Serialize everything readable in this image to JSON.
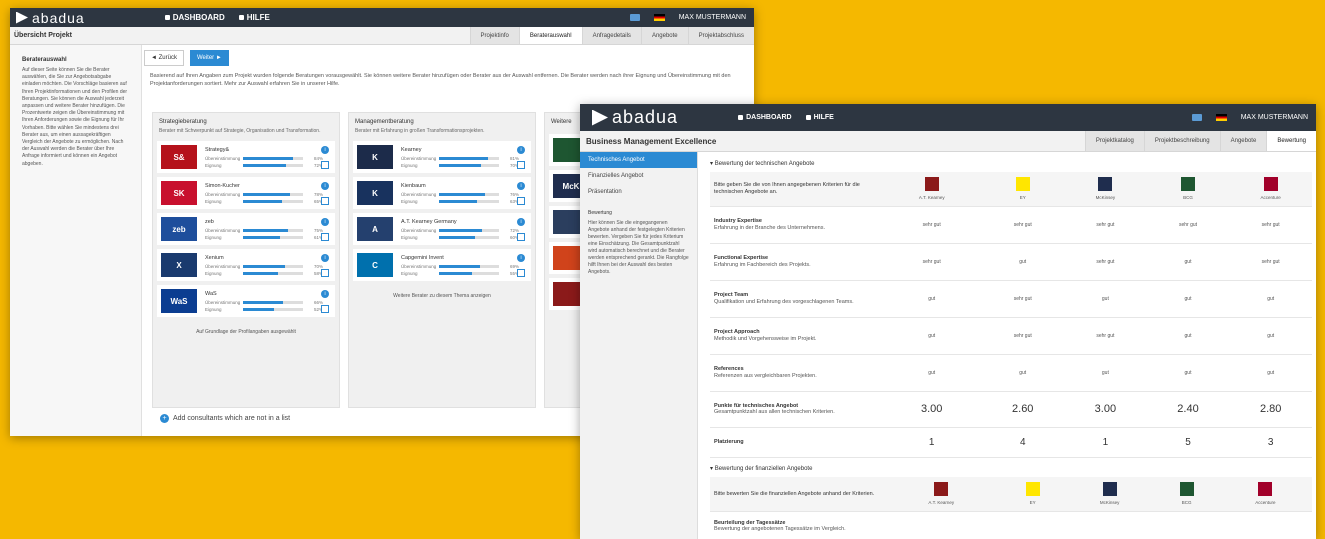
{
  "brand": {
    "name": "abadua",
    "background": "#f5b800",
    "accent": "#2b8ad3",
    "topbar": "#2d3641"
  },
  "w1": {
    "nav": [
      "DASHBOARD",
      "HILFE"
    ],
    "user": "MAX MUSTERMANN",
    "subtitle": "Übersicht Projekt",
    "tabs": [
      {
        "label": "Projektinfo",
        "active": false
      },
      {
        "label": "Beraterauswahl",
        "active": true
      },
      {
        "label": "Anfragedetails",
        "active": false
      },
      {
        "label": "Angebote",
        "active": false
      },
      {
        "label": "Projektabschluss",
        "active": false
      }
    ],
    "sidebar": {
      "heading": "Beraterauswahl",
      "text": "Auf dieser Seite können Sie die Berater auswählen, die Sie zur Angebotsabgabe einladen möchten. Die Vorschläge basieren auf Ihren Projektinformationen und den Profilen der Beratungen. Sie können die Auswahl jederzeit anpassen und weitere Berater hinzufügen. Die Prozentwerte zeigen die Übereinstimmung mit Ihren Anforderungen sowie die Eignung für Ihr Vorhaben. Bitte wählen Sie mindestens drei Berater aus, um einen aussagekräftigen Vergleich der Angebote zu ermöglichen. Nach der Auswahl werden die Berater über Ihre Anfrage informiert und können ein Angebot abgeben."
    },
    "buttons": {
      "back": "◄ Zurück",
      "next": "Weiter ►"
    },
    "intro": "Basierend auf Ihren Angaben zum Projekt wurden folgende Beratungen vorausgewählt. Sie können weitere Berater hinzufügen oder Berater aus der Auswahl entfernen. Die Berater werden nach ihrer Eignung und Übereinstimmung mit den Projektanforderungen sortiert. Mehr zur Auswahl erfahren Sie in unserer Hilfe.",
    "panels": [
      {
        "title": "Strategieberatung",
        "desc": "Berater mit Schwerpunkt auf Strategie, Organisation und Transformation.",
        "cards": [
          {
            "name": "Strategy&",
            "color": "#b5121b",
            "logo": "S&",
            "m1": 84,
            "m2": 72
          },
          {
            "name": "Simon-Kucher",
            "color": "#c8102e",
            "logo": "SK",
            "m1": 78,
            "m2": 65
          },
          {
            "name": "zeb",
            "color": "#1e4e9c",
            "logo": "zeb",
            "m1": 75,
            "m2": 61
          },
          {
            "name": "Xenium",
            "color": "#1a3a6e",
            "logo": "X",
            "m1": 70,
            "m2": 58
          },
          {
            "name": "WaS",
            "color": "#0b3d91",
            "logo": "WaS",
            "m1": 66,
            "m2": 52
          }
        ],
        "foot": "Auf Grundlage der Profilangaben ausgewählt"
      },
      {
        "title": "Managementberatung",
        "desc": "Berater mit Erfahrung in großen Transformationsprojekten.",
        "cards": [
          {
            "name": "Kearney",
            "color": "#1c2b4a",
            "logo": "K",
            "m1": 81,
            "m2": 70
          },
          {
            "name": "Kienbaum",
            "color": "#18325e",
            "logo": "K",
            "m1": 76,
            "m2": 63
          },
          {
            "name": "A.T. Kearney Germany",
            "color": "#24406e",
            "logo": "A",
            "m1": 72,
            "m2": 60
          },
          {
            "name": "Capgemini Invent",
            "color": "#0070ad",
            "logo": "C",
            "m1": 69,
            "m2": 55
          }
        ],
        "foot": "Weitere Berater zu diesem Thema anzeigen"
      },
      {
        "title": "Weitere",
        "desc": "",
        "cards": [
          {
            "name": "",
            "color": "#1e5631",
            "logo": "",
            "m1": 0,
            "m2": 0
          },
          {
            "name": "",
            "color": "#1f2d4e",
            "logo": "McK",
            "m1": 0,
            "m2": 0
          },
          {
            "name": "",
            "color": "#2b3e5e",
            "logo": "",
            "m1": 0,
            "m2": 0
          },
          {
            "name": "",
            "color": "#d0431b",
            "logo": "",
            "m1": 0,
            "m2": 0
          },
          {
            "name": "",
            "color": "#8b1a1a",
            "logo": "",
            "m1": 0,
            "m2": 0
          }
        ],
        "foot": ""
      }
    ],
    "metric_labels": {
      "m1": "Übereinstimmung",
      "m2": "Eignung"
    },
    "add_label": "Add consultants which are not in a list"
  },
  "w2": {
    "nav": [
      "DASHBOARD",
      "HILFE"
    ],
    "user": "MAX MUSTERMANN",
    "subtitle": "Business Management Excellence",
    "tabs": [
      {
        "label": "Projektkatalog",
        "active": false
      },
      {
        "label": "Projektbeschreibung",
        "active": false
      },
      {
        "label": "Angebote",
        "active": false
      },
      {
        "label": "Bewertung",
        "active": true
      }
    ],
    "sidebar": {
      "items": [
        {
          "label": "Technisches Angebot",
          "active": true
        },
        {
          "label": "Finanzielles Angebot",
          "active": false
        },
        {
          "label": "Präsentation",
          "active": false
        }
      ],
      "heading": "Bewertung",
      "text": "Hier können Sie die eingegangenen Angebote anhand der festgelegten Kriterien bewerten. Vergeben Sie für jedes Kriterium eine Einschätzung. Die Gesamtpunktzahl wird automatisch berechnet und die Berater werden entsprechend gerankt. Die Rangfolge hilft Ihnen bei der Auswahl des besten Angebots."
    },
    "section1": "Bewertung der technischen Angebote",
    "section2": "Bewertung der finanziellen Angebote",
    "header_crit": "Bitte geben Sie die von Ihnen angegebenen Kriterien für die technischen Angebote an.",
    "header_crit2": "Bitte bewerten Sie die finanziellen Angebote anhand der Kriterien.",
    "consultants": [
      {
        "name": "A.T. Kearney",
        "color": "#8b1a1a"
      },
      {
        "name": "EY",
        "color": "#ffe600"
      },
      {
        "name": "McKinsey",
        "color": "#1f2d4e"
      },
      {
        "name": "BCG",
        "color": "#1e5631"
      },
      {
        "name": "Accenture",
        "color": "#a1002a"
      }
    ],
    "criteria": [
      {
        "name": "Industry Expertise",
        "desc": "Erfahrung in der Branche des Unternehmens.",
        "values": [
          "sehr gut",
          "sehr gut",
          "sehr gut",
          "sehr gut",
          "sehr gut"
        ]
      },
      {
        "name": "Functional Expertise",
        "desc": "Erfahrung im Fachbereich des Projekts.",
        "values": [
          "sehr gut",
          "gut",
          "sehr gut",
          "gut",
          "sehr gut"
        ]
      },
      {
        "name": "Project Team",
        "desc": "Qualifikation und Erfahrung des vorgeschlagenen Teams.",
        "values": [
          "gut",
          "sehr gut",
          "gut",
          "gut",
          "gut"
        ]
      },
      {
        "name": "Project Approach",
        "desc": "Methodik und Vorgehensweise im Projekt.",
        "values": [
          "gut",
          "sehr gut",
          "sehr gut",
          "gut",
          "gut"
        ]
      },
      {
        "name": "References",
        "desc": "Referenzen aus vergleichbaren Projekten.",
        "values": [
          "gut",
          "gut",
          "gut",
          "gut",
          "gut"
        ]
      }
    ],
    "score_row": {
      "name": "Punkte für technisches Angebot",
      "desc": "Gesamtpunktzahl aus allen technischen Kriterien.",
      "values": [
        "3.00",
        "2.60",
        "3.00",
        "2.40",
        "2.80"
      ]
    },
    "rank_row": {
      "name": "Platzierung",
      "values": [
        "1",
        "4",
        "1",
        "5",
        "3"
      ]
    },
    "fin_row": {
      "name": "Beurteilung der Tagessätze",
      "desc": "Bewertung der angebotenen Tagessätze im Vergleich."
    }
  }
}
